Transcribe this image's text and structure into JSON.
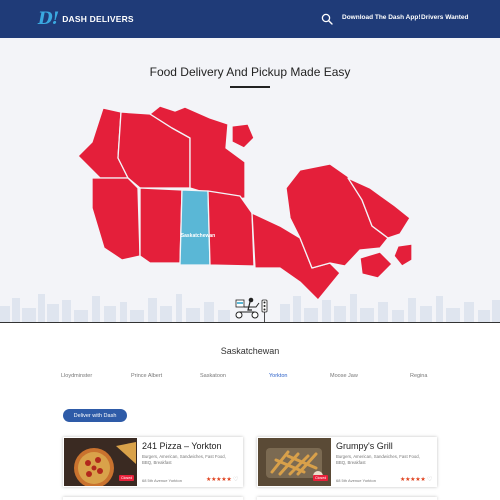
{
  "header": {
    "logo_mark": "D!",
    "logo_text": "DASH DELIVERS",
    "nav": {
      "app": "Download The Dash App!",
      "drivers": "Drivers Wanted"
    }
  },
  "hero": {
    "title": "Food Delivery And Pickup Made Easy",
    "selected_region_label": "Saskatchewan"
  },
  "colors": {
    "map_red": "#e41f3a",
    "map_selected": "#5ab7d6",
    "header_blue": "#1f3b78",
    "accent_blue": "#2f63c9"
  },
  "province": {
    "name": "Saskatchewan",
    "cities": [
      "Lloydminster",
      "Prince Albert",
      "Saskatoon",
      "Yorkton",
      "Moose Jaw",
      "Regina"
    ],
    "active_city": "Yorkton"
  },
  "cta": {
    "deliver": "Deliver with Dash"
  },
  "restaurants": [
    {
      "name": "241 Pizza – Yorkton",
      "tags": "Burgers, American, Sandwiches, Fast Food, BBQ, Breakfast",
      "address": "68 5th Avenue Yorkton",
      "badge": "Closed",
      "stars": "★★★★★",
      "rating": 5,
      "icon": "heart-icon"
    },
    {
      "name": "Grumpy's Grill",
      "tags": "Burgers, American, Sandwiches, Fast Food, BBQ, Breakfast",
      "address": "68 5th Avenue Yorkton",
      "badge": "Closed",
      "stars": "★★★★★",
      "rating": 5,
      "icon": "heart-icon"
    }
  ]
}
